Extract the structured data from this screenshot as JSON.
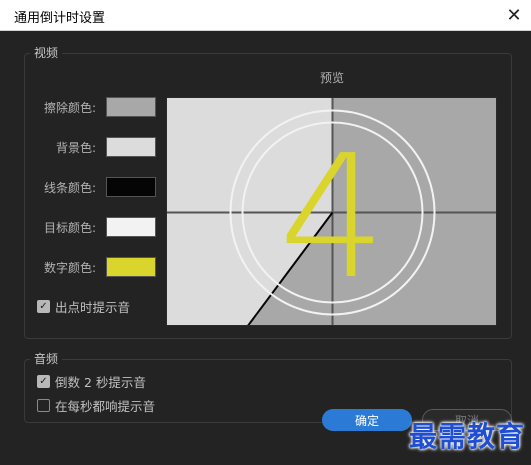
{
  "window": {
    "title": "通用倒计时设置",
    "close_glyph": "✕"
  },
  "video_group": {
    "legend": "视频",
    "preview_label": "预览",
    "colors": [
      {
        "label": "擦除颜色:",
        "hex": "#a8a8a8"
      },
      {
        "label": "背景色:",
        "hex": "#dcdcdc"
      },
      {
        "label": "线条颜色:",
        "hex": "#050505"
      },
      {
        "label": "目标颜色:",
        "hex": "#f2f2f2"
      },
      {
        "label": "数字颜色:",
        "hex": "#d9d52c"
      }
    ],
    "cue_at_out": {
      "label": "出点时提示音",
      "checked": true
    }
  },
  "preview": {
    "digit": "4",
    "wipe_color": "#a8a8a8",
    "background_color": "#dcdcdc",
    "line_color": "#050505",
    "target_color": "#f2f2f2",
    "digit_color": "#d9d52c"
  },
  "audio_group": {
    "legend": "音频",
    "options": [
      {
        "label": "倒数 2 秒提示音",
        "checked": true
      },
      {
        "label": "在每秒都响提示音",
        "checked": false
      }
    ]
  },
  "buttons": {
    "ok": "确定",
    "cancel": "取消"
  },
  "watermark": "最需教育"
}
